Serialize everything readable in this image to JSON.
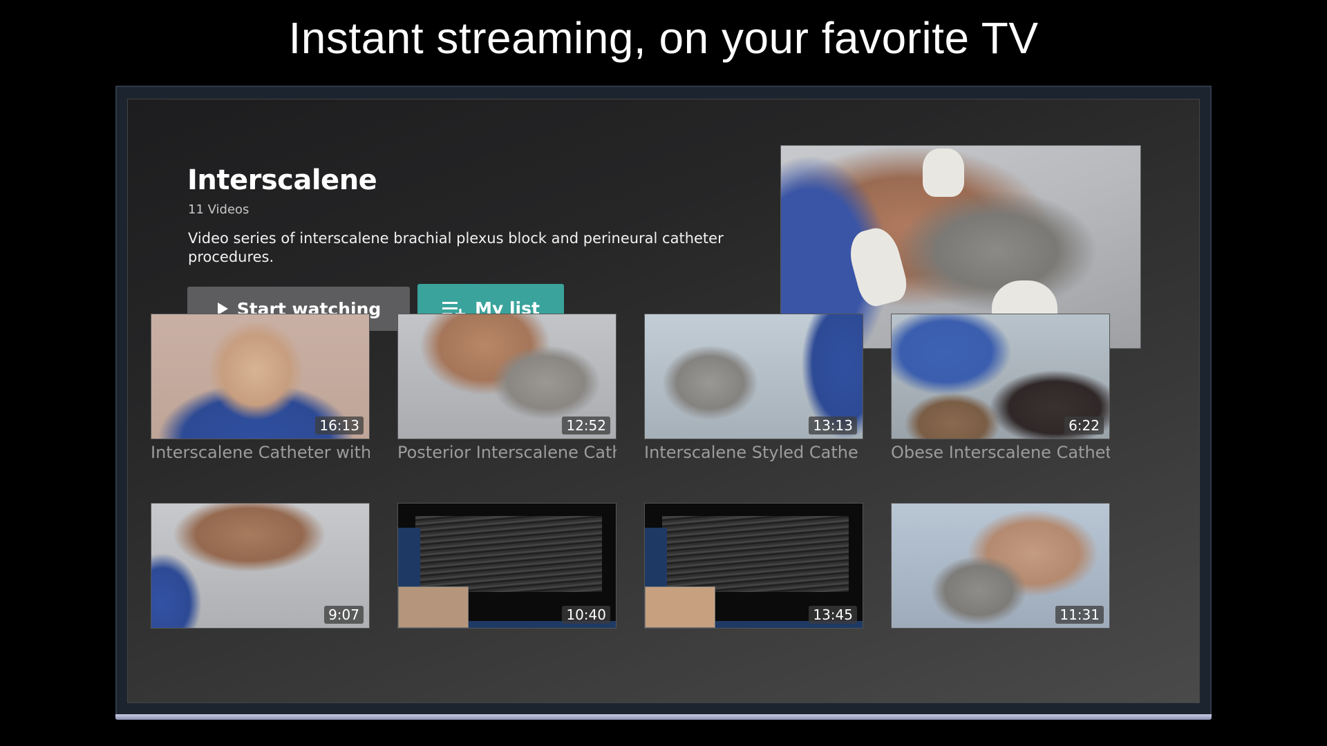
{
  "headline": "Instant streaming, on your favorite TV",
  "series": {
    "title": "Interscalene",
    "count": "11 Videos",
    "description": "Video series of interscalene brachial plexus block and perineural catheter procedures."
  },
  "buttons": {
    "start_watching": "Start watching",
    "my_list": "My list"
  },
  "colors": {
    "my_list_accent": "#3aa39b",
    "start_button": "#5d5d5f",
    "background": "#000000"
  },
  "videos": [
    {
      "title": "Interscalene Catheter with",
      "duration": "16:13"
    },
    {
      "title": "Posterior Interscalene Cath",
      "duration": "12:52"
    },
    {
      "title": "Interscalene Styled Cathe",
      "duration": "13:13"
    },
    {
      "title": "Obese Interscalene Cathet",
      "duration": "6:22"
    },
    {
      "title": "",
      "duration": "9:07"
    },
    {
      "title": "",
      "duration": "10:40"
    },
    {
      "title": "",
      "duration": "13:45"
    },
    {
      "title": "",
      "duration": "11:31"
    }
  ]
}
